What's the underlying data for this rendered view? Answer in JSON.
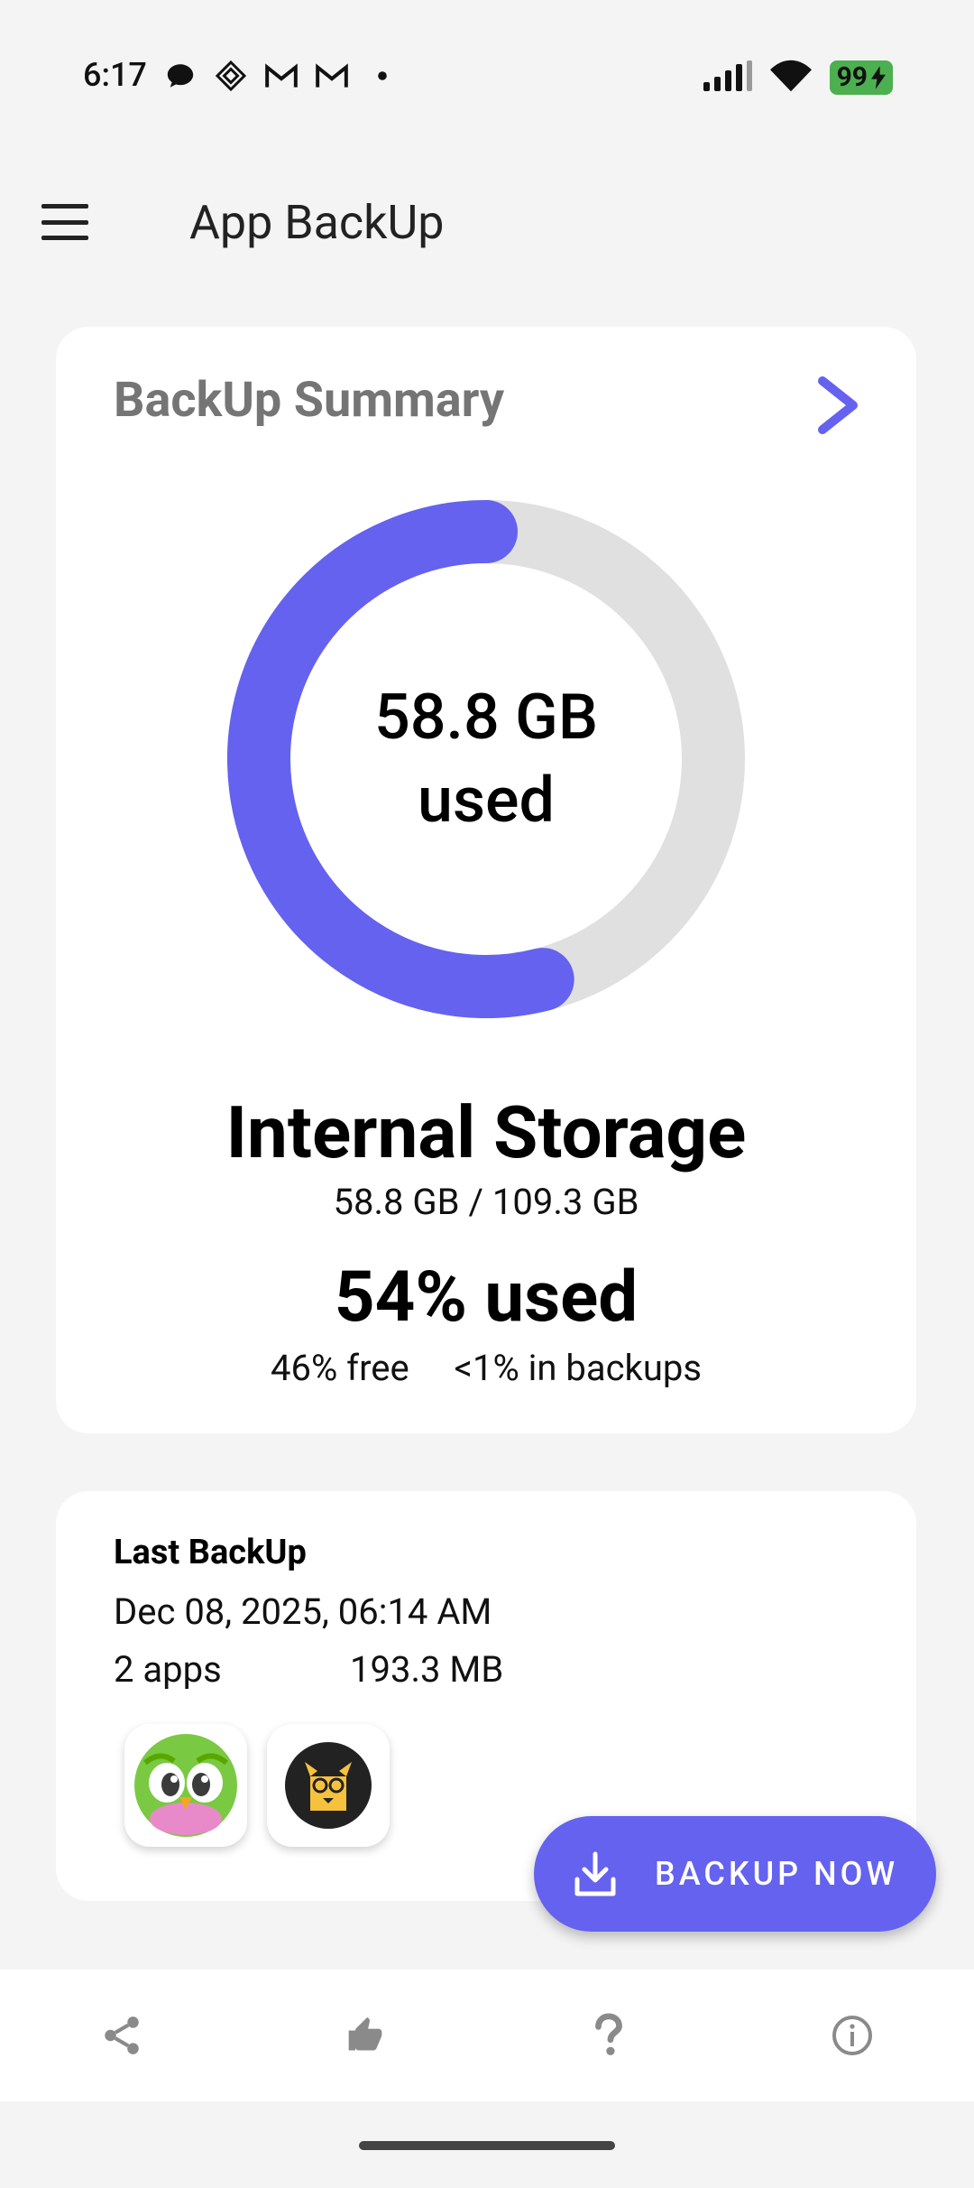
{
  "status_bar": {
    "time": "6:17",
    "battery": "99",
    "left_icons": [
      "messages-icon",
      "slack-icon",
      "gmail-icon",
      "gmail-icon",
      "dot-icon"
    ],
    "right_icons": [
      "signal-icon",
      "wifi-icon",
      "battery-icon"
    ]
  },
  "app_bar": {
    "title": "App BackUp",
    "menu_icon": "hamburger-icon"
  },
  "summary": {
    "title": "BackUp Summary",
    "donut_center_line1": "58.8 GB",
    "donut_center_line2": "used",
    "storage_name": "Internal Storage",
    "storage_amount": "58.8 GB / 109.3 GB",
    "used_percent": "54% used",
    "free": "46% free",
    "in_backups": "<1% in backups",
    "used_fraction": 0.54,
    "accent_color": "#6462ef",
    "track_color": "#e0e0e0"
  },
  "last_backup": {
    "title": "Last BackUp",
    "date": "Dec 08, 2025, 06:14 AM",
    "apps": "2 apps",
    "size": "193.3 MB",
    "app_icons": [
      "duolingo-icon",
      "reading-app-icon"
    ]
  },
  "fab": {
    "label": "BACKUP NOW",
    "icon": "download-icon"
  },
  "bottom_nav": [
    "share-icon",
    "thumbs-up-icon",
    "help-icon",
    "info-icon"
  ]
}
